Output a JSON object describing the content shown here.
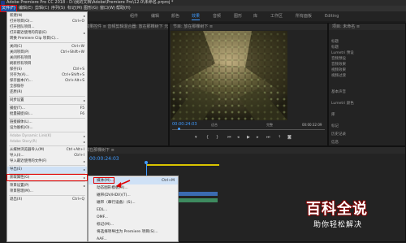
{
  "window": {
    "title": "Adobe Premiere Pro CC 2018 - D:\\我的文档\\Adobe\\Premiere Pro\\12.0\\未命名.prproj *"
  },
  "menubar": {
    "items": [
      "文件(F)",
      "编辑(E)",
      "剪辑(C)",
      "序列(S)",
      "标记(M)",
      "图形(G)",
      "窗口(W)",
      "帮助(H)"
    ]
  },
  "workspaces": {
    "tabs": [
      "组件",
      "编辑",
      "颜色",
      "效果",
      "音频",
      "图形",
      "库",
      "工作区",
      "所有面板",
      "Editing"
    ],
    "active": "编辑"
  },
  "source_panel": {
    "title": "效果控件 ≡  音频剪辑混合器: 放在那棵树下  元数据"
  },
  "program_panel": {
    "title": "节目: 放在那棵树下 ≡",
    "timecode_left": "00:00:24:03",
    "fit_label": "适合",
    "fraction": "完整",
    "timecode_right": "00:00:32:09"
  },
  "project_panel": {
    "title": "项目: 未命名 ≡",
    "items": [
      "标题",
      "标题",
      "Lumetri 预设",
      "音频预设",
      "音频效果",
      "视频效果",
      "视频过渡"
    ],
    "sections": [
      "基本声音",
      "Lumetri 颜色",
      "库",
      "标记",
      "历史记录",
      "信息"
    ]
  },
  "timeline": {
    "title": "放在那棵树下 ≡",
    "timecode": "00:00:24:03"
  },
  "file_menu": {
    "items": [
      {
        "label": "新建(N)",
        "shortcut": "",
        "arrow": true
      },
      {
        "label": "打开项目(O)...",
        "shortcut": "Ctrl+O"
      },
      {
        "label": "打开团队项目...",
        "shortcut": ""
      },
      {
        "label": "打开最近使用的内容(E)",
        "shortcut": "",
        "arrow": true
      },
      {
        "label": "转换 Premiere Clip 项目(C)...",
        "shortcut": ""
      },
      {
        "sep": true
      },
      {
        "label": "关闭(C)",
        "shortcut": "Ctrl+W"
      },
      {
        "label": "关闭项目(P)",
        "shortcut": "Ctrl+Shift+W"
      },
      {
        "label": "关闭所有项目",
        "shortcut": ""
      },
      {
        "label": "刷新所有项目",
        "shortcut": ""
      },
      {
        "label": "保存(S)",
        "shortcut": "Ctrl+S"
      },
      {
        "label": "另存为(A)...",
        "shortcut": "Ctrl+Shift+S"
      },
      {
        "label": "保存副本(Y)...",
        "shortcut": "Ctrl+Alt+S"
      },
      {
        "label": "全部保存",
        "shortcut": ""
      },
      {
        "label": "还原(R)",
        "shortcut": ""
      },
      {
        "sep": true
      },
      {
        "label": "同步设置",
        "shortcut": "",
        "arrow": true
      },
      {
        "sep": true
      },
      {
        "label": "捕捉(T)...",
        "shortcut": "F5"
      },
      {
        "label": "批量捕捉(B)...",
        "shortcut": "F6"
      },
      {
        "sep": true
      },
      {
        "label": "链接媒体(L)...",
        "shortcut": ""
      },
      {
        "label": "设为脱机(O)...",
        "shortcut": ""
      },
      {
        "sep": true
      },
      {
        "label": "Adobe Dynamic Link(K)",
        "shortcut": "",
        "arrow": true,
        "disabled": true
      },
      {
        "label": "Adobe Story(R)",
        "shortcut": "",
        "arrow": true,
        "disabled": true
      },
      {
        "sep": true
      },
      {
        "label": "从媒体浏览器导入(M)",
        "shortcut": "Ctrl+Alt+I"
      },
      {
        "label": "导入(I)...",
        "shortcut": "Ctrl+I"
      },
      {
        "label": "导入最近使用的文件(F)",
        "shortcut": "",
        "arrow": true
      },
      {
        "sep": true
      },
      {
        "label": "导出(E)",
        "shortcut": "",
        "arrow": true,
        "selected": true
      },
      {
        "sep": true
      },
      {
        "label": "获取属性(G)",
        "shortcut": "",
        "arrow": true
      },
      {
        "sep": true
      },
      {
        "label": "项目设置(P)",
        "shortcut": "",
        "arrow": true
      },
      {
        "label": "项目管理(M)...",
        "shortcut": ""
      },
      {
        "sep": true
      },
      {
        "label": "退出(X)",
        "shortcut": "Ctrl+Q"
      }
    ]
  },
  "export_submenu": {
    "items": [
      {
        "label": "媒体(M)...",
        "shortcut": "Ctrl+M",
        "selected": true
      },
      {
        "label": "动态图形模板(R)...",
        "shortcut": ""
      },
      {
        "label": "磁带(DV/HDV)(T)...",
        "shortcut": ""
      },
      {
        "label": "磁带（串行设备）(S)...",
        "shortcut": ""
      },
      {
        "label": "EDL...",
        "shortcut": ""
      },
      {
        "label": "OMF...",
        "shortcut": ""
      },
      {
        "label": "标记(M)...",
        "shortcut": ""
      },
      {
        "label": "将选择项导出为 Premiere 项目(S)...",
        "shortcut": ""
      },
      {
        "label": "AAF...",
        "shortcut": ""
      }
    ]
  },
  "watermark": {
    "title": "百科全说",
    "subtitle": "助你轻松解决"
  },
  "colors": {
    "accent": "#3f9bff",
    "highlight_red": "#e00000",
    "menu_bg": "#efefef"
  }
}
